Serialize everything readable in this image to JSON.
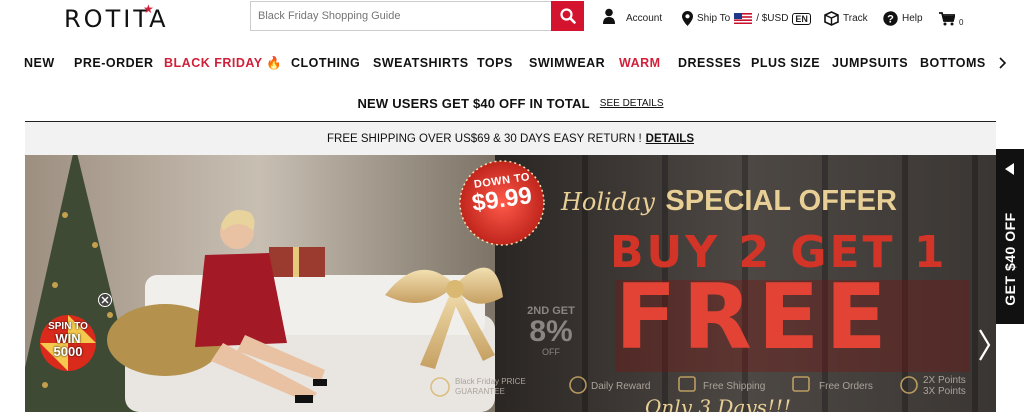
{
  "brand": {
    "logo": "ROTITA"
  },
  "search": {
    "placeholder": "Black Friday Shopping Guide"
  },
  "header": {
    "account": "Account",
    "ship_to": "Ship To",
    "currency": "/ $USD",
    "language": "EN",
    "track": "Track",
    "help": "Help",
    "cart_count": "0"
  },
  "nav": {
    "items": [
      "NEW",
      "PRE-ORDER",
      "BLACK FRIDAY",
      "CLOTHING",
      "SWEATSHIRTS",
      "TOPS",
      "SWIMWEAR",
      "WARM",
      "DRESSES",
      "PLUS SIZE",
      "JUMPSUITS",
      "BOTTOMS"
    ]
  },
  "promo": {
    "new_users": "NEW USERS GET $40 OFF IN TOTAL",
    "see_details": "SEE DETAILS",
    "shipping": "FREE SHIPPING OVER US$69 & 30 DAYS EASY RETURN !",
    "details": "DETAILS"
  },
  "banner": {
    "down_to": "DOWN TO",
    "price": "$9.99",
    "holiday": "Holiday",
    "special_offer": "SPECIAL OFFER",
    "buy2get1": "BUY 2 GET 1",
    "free": "FREE",
    "spin": "SPIN TO",
    "win": "WIN",
    "win_amount": "5000",
    "second_get": "2ND GET",
    "second_pct": "8%",
    "second_off": "OFF",
    "black_friday_guarantee": "Black Friday PRICE GUARANTEE",
    "daily_reward": "Daily Reward",
    "free_shipping": "Free Shipping",
    "free_orders": "Free Orders",
    "points2": "2X Points",
    "points3": "3X Points",
    "script_bottom": "Only 3 Days!!!"
  },
  "side_tab": {
    "label": "GET $40 OFF"
  },
  "colors": {
    "accent": "#d4142f",
    "nav_red": "#d0203a",
    "dark": "#111111"
  }
}
